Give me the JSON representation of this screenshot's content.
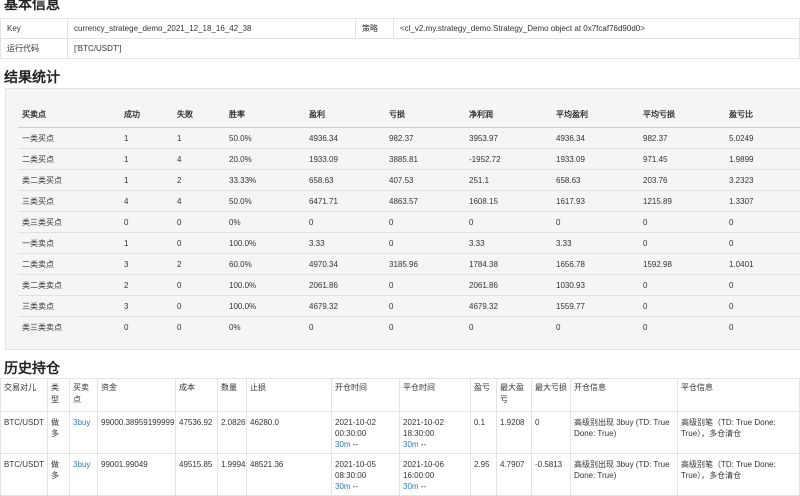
{
  "basic": {
    "title": "基本信息",
    "key_label": "Key",
    "key_value": "currency_stratege_demo_2021_12_18_16_42_38",
    "strategy_label": "策略",
    "strategy_value": "<cl_v2.my.strategy_demo.Strategy_Demo object at 0x7fcaf76d90d0>",
    "code_label": "运行代码",
    "code_value": "['BTC/USDT']"
  },
  "stats": {
    "title": "结果统计",
    "headers": [
      "买卖点",
      "成功",
      "失败",
      "胜率",
      "盈利",
      "亏损",
      "净利润",
      "平均盈利",
      "平均亏损",
      "盈亏比"
    ],
    "rows": [
      [
        "一类买点",
        "1",
        "1",
        "50.0%",
        "4936.34",
        "982.37",
        "3953.97",
        "4936.34",
        "982.37",
        "5.0249"
      ],
      [
        "二类买点",
        "1",
        "4",
        "20.0%",
        "1933.09",
        "3885.81",
        "-1952.72",
        "1933.09",
        "971.45",
        "1.9899"
      ],
      [
        "类二类买点",
        "1",
        "2",
        "33.33%",
        "658.63",
        "407.53",
        "251.1",
        "658.63",
        "203.76",
        "3.2323"
      ],
      [
        "三类买点",
        "4",
        "4",
        "50.0%",
        "6471.71",
        "4863.57",
        "1608.15",
        "1617.93",
        "1215.89",
        "1.3307"
      ],
      [
        "类三类买点",
        "0",
        "0",
        "0%",
        "0",
        "0",
        "0",
        "0",
        "0",
        "0"
      ],
      [
        "一类卖点",
        "1",
        "0",
        "100.0%",
        "3.33",
        "0",
        "3.33",
        "3.33",
        "0",
        "0"
      ],
      [
        "二类卖点",
        "3",
        "2",
        "60.0%",
        "4970.34",
        "3185.96",
        "1784.38",
        "1656.78",
        "1592.98",
        "1.0401"
      ],
      [
        "类二类卖点",
        "2",
        "0",
        "100.0%",
        "2061.86",
        "0",
        "2061.86",
        "1030.93",
        "0",
        "0"
      ],
      [
        "三类卖点",
        "3",
        "0",
        "100.0%",
        "4679.32",
        "0",
        "4679.32",
        "1559.77",
        "0",
        "0"
      ],
      [
        "类三类卖点",
        "0",
        "0",
        "0%",
        "0",
        "0",
        "0",
        "0",
        "0",
        "0"
      ]
    ]
  },
  "history": {
    "title": "历史持仓",
    "headers": [
      "交易对儿",
      "类型",
      "买卖点",
      "资金",
      "成本",
      "数量",
      "止损",
      "开仓时间",
      "平仓时间",
      "盈亏",
      "最大盈亏",
      "最大亏损",
      "开仓信息",
      "平仓信息"
    ],
    "rows": [
      {
        "pair": "BTC/USDT",
        "type": "做多",
        "point": "3buy",
        "fund": "99000.38959199999",
        "cost": "47536.92",
        "qty": "2.0826",
        "stop": "46280.0",
        "open_time": "2021-10-02 00:30:00",
        "open_link": "30m",
        "open_extra": "--",
        "close_time": "2021-10-02 18:30:00",
        "close_link": "30m",
        "close_extra": "--",
        "pnl": "0.1",
        "max_pnl": "1.9208",
        "max_loss": "0",
        "open_info": "高级别出现 3buy (TD: True Done: True)",
        "close_info": "高级别笔（TD: True Done: True），多仓清仓"
      },
      {
        "pair": "BTC/USDT",
        "type": "做多",
        "point": "3buy",
        "fund": "99001.99049",
        "cost": "49515.85",
        "qty": "1.9994",
        "stop": "48521.36",
        "open_time": "2021-10-05 08:30:00",
        "open_link": "30m",
        "open_extra": "--",
        "close_time": "2021-10-06 16:00:00",
        "close_link": "30m",
        "close_extra": "--",
        "pnl": "2.95",
        "max_pnl": "4.7907",
        "max_loss": "-0.5813",
        "open_info": "高级别出现 3buy (TD: True Done: True)",
        "close_info": "高级别笔（TD: True Done: True），多仓清仓"
      }
    ]
  }
}
